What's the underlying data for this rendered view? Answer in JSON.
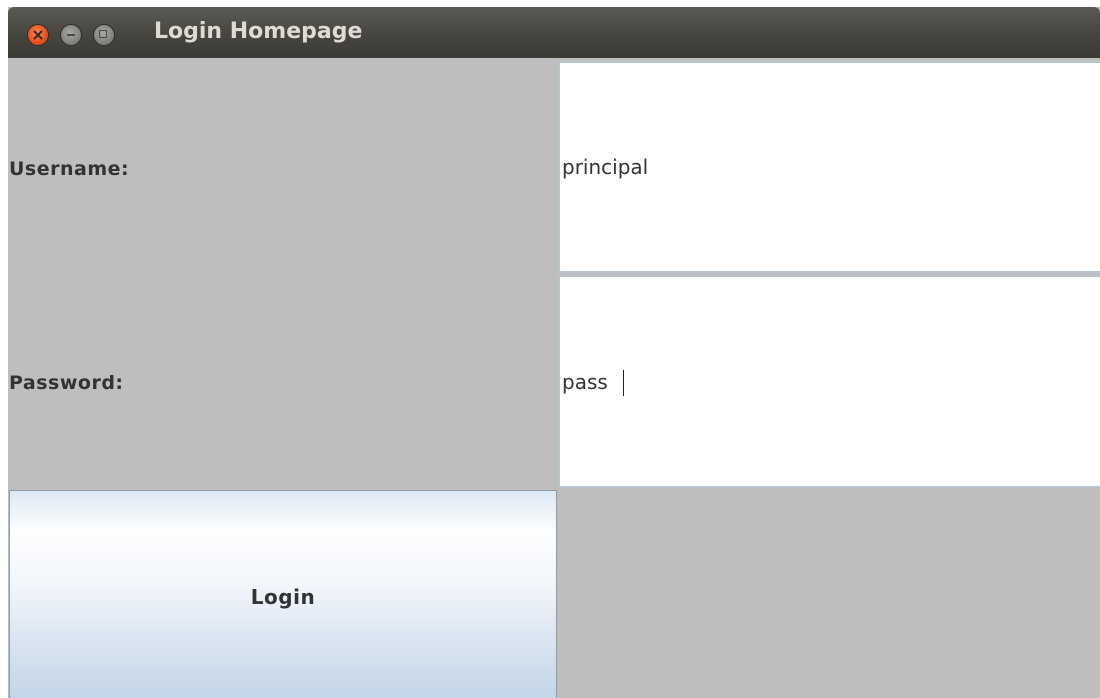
{
  "window": {
    "title": "Login Homepage",
    "buttons": {
      "close": "close-icon",
      "minimize": "minimize-icon",
      "maximize": "maximize-icon"
    }
  },
  "form": {
    "username_label": "Username:",
    "username_value": "principal",
    "password_label": "Password:",
    "password_value": "pass",
    "login_label": "Login"
  },
  "colors": {
    "titlebar": "#47453f",
    "panel_background": "#bebebe",
    "close_button": "#e95420",
    "button_gradient_bottom": "#c3d5e8"
  }
}
